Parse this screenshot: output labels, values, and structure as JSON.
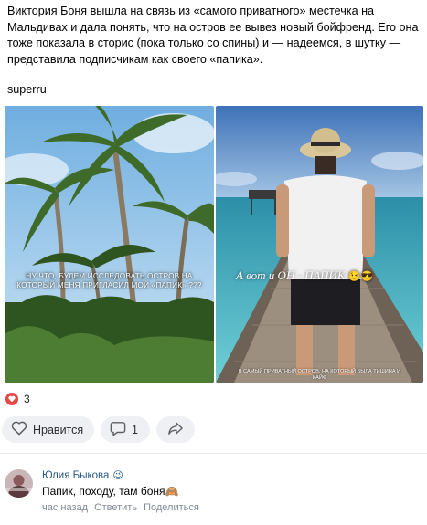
{
  "post": {
    "text": "Виктория Боня вышла на связь из «самого приватного» местечка на Мальдивах и дала понять, что на остров ее вывез новый бойфренд. Его она тоже показала в сторис (пока только со спины) и — надеемся, в шутку — представила подписчикам как своего «папика».",
    "source": "superru"
  },
  "photos": {
    "left_caption": "НУ ЧТО, БУДЕМ ИССЛЕДОВАТЬ ОСТРОВ НА КОТОРЫЙ МЕНЯ ПРИГЛАСИЛ МОЙ «ПАПИК» ???",
    "right_caption": "А вот и ОН - ПАПИК",
    "right_caption_emoji": "😉😎",
    "right_small_caption": "В САМЫЙ ПРИВАТНЫЙ ОСТРОВ, НА КОТОРЫЙ БЫЛА ТИШИНА И КАЙФ"
  },
  "reactions": {
    "count": "3",
    "icon": "heart-icon",
    "color": "#e64646"
  },
  "actions": {
    "like_label": "Нравится",
    "comment_count": "1",
    "like_icon": "heart-outline-icon",
    "comment_icon": "comment-icon",
    "share_icon": "share-icon"
  },
  "comment": {
    "author": "Юлия Быкова",
    "author_emoji": "😉",
    "text": "Папик, походу, там боня🙈",
    "time": "час назад",
    "reply_label": "Ответить",
    "share_label": "Поделиться"
  }
}
